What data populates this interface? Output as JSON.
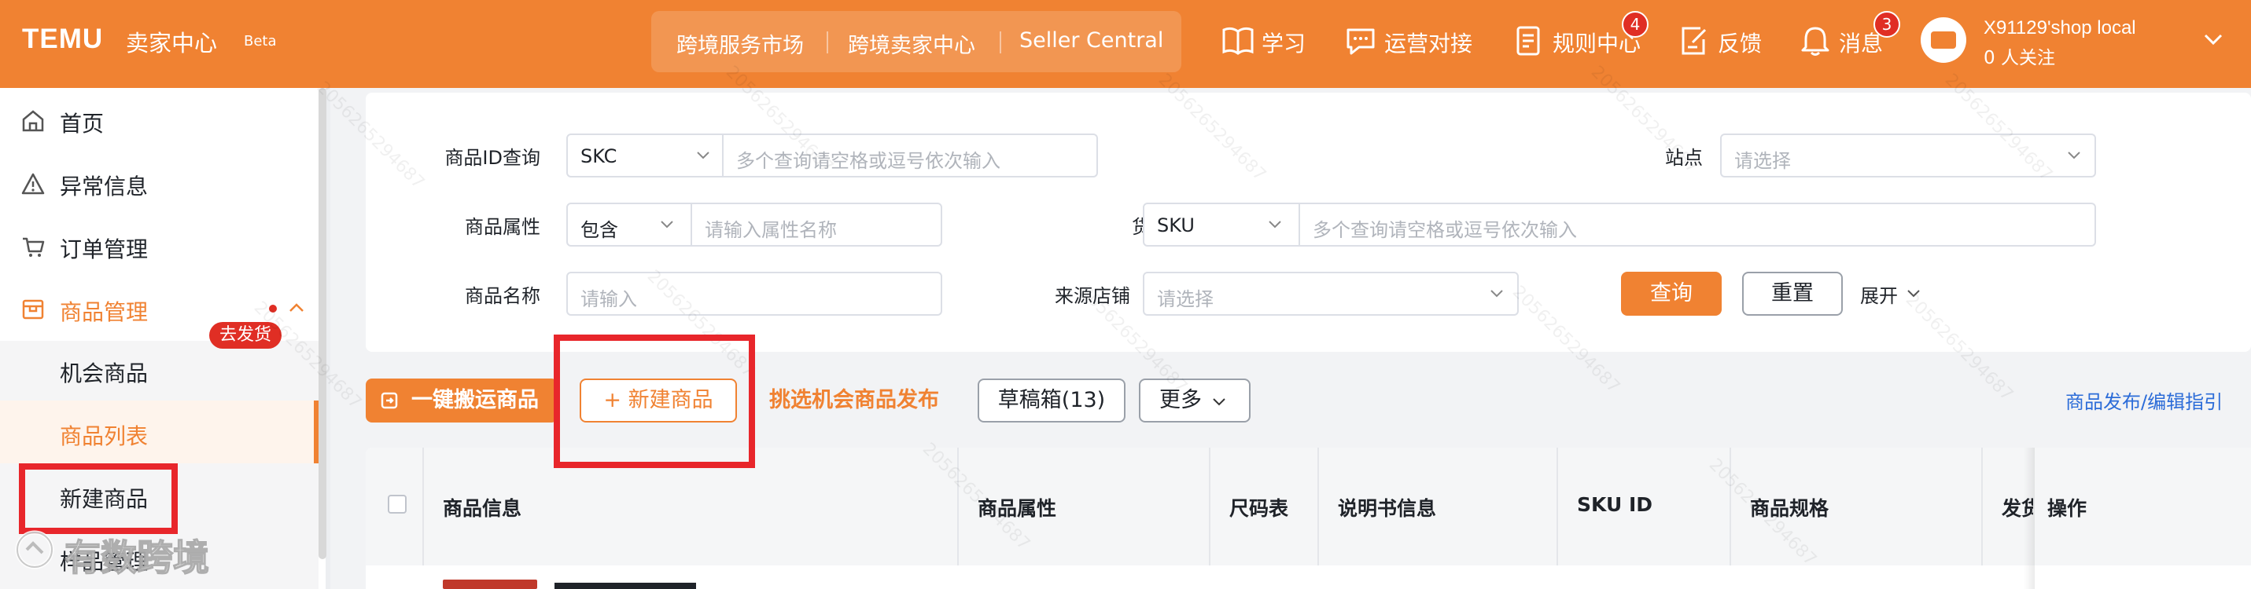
{
  "header": {
    "logo": "TEMU",
    "logo_sub": "卖家中心",
    "beta": "Beta",
    "nav": [
      "跨境服务市场",
      "跨境卖家中心",
      "Seller Central"
    ],
    "tools": [
      {
        "icon": "book-icon",
        "label": "学习"
      },
      {
        "icon": "chat-icon",
        "label": "运营对接"
      },
      {
        "icon": "document-icon",
        "label": "规则中心",
        "badge": "4"
      },
      {
        "icon": "feedback-icon",
        "label": "反馈"
      },
      {
        "icon": "bell-icon",
        "label": "消息",
        "badge": "3"
      }
    ],
    "shop_name": "X91129'shop local",
    "followers": "0 人关注",
    "accent": "#f08232"
  },
  "sidebar": {
    "items": [
      {
        "icon": "home-icon",
        "label": "首页"
      },
      {
        "icon": "warning-icon",
        "label": "异常信息"
      },
      {
        "icon": "cart-icon",
        "label": "订单管理",
        "tag": "去发货"
      },
      {
        "icon": "product-icon",
        "label": "商品管理"
      }
    ],
    "sub_items": [
      "机会商品",
      "商品列表",
      "新建商品",
      "样品管理"
    ]
  },
  "filters": {
    "id_query_label": "商品ID查询",
    "id_type": "SKC",
    "id_placeholder": "多个查询请空格或逗号依次输入",
    "site_label": "站点",
    "site_placeholder": "请选择",
    "attr_label": "商品属性",
    "attr_mode": "包含",
    "attr_placeholder": "请输入属性名称",
    "sku_label": "货号",
    "sku_type": "SKU",
    "sku_placeholder": "多个查询请空格或逗号依次输入",
    "name_label": "商品名称",
    "name_placeholder": "请输入",
    "source_label": "来源店铺",
    "source_placeholder": "请选择",
    "query_btn": "查询",
    "reset_btn": "重置",
    "expand": "展开"
  },
  "actions": {
    "one_click": "一键搬运商品",
    "new_product": "+ 新建商品",
    "select_publish": "挑选机会商品发布",
    "drafts": "草稿箱(13)",
    "more": "更多",
    "guide_link": "商品发布/编辑指引"
  },
  "table": {
    "headers": [
      "商品信息",
      "商品属性",
      "尺码表",
      "说明书信息",
      "SKU ID",
      "商品规格",
      "发货",
      "操作"
    ]
  },
  "watermark": {
    "text": "2056265294687",
    "brand": "有数跨境"
  }
}
